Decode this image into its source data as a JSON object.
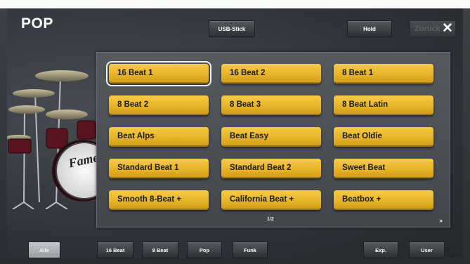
{
  "header": {
    "title": "POP",
    "usb_label": "USB-Stick",
    "hold_label": "Hold",
    "back_label": "Zurück",
    "close_icon": "✕"
  },
  "drum_logo": "Fame",
  "styles": [
    "16 Beat 1",
    "16 Beat 2",
    "8 Beat 1",
    "8 Beat 2",
    "8 Beat 3",
    "8 Beat Latin",
    "Beat Alps",
    "Beat Easy",
    "Beat Oldie",
    "Standard Beat 1",
    "Standard Beat 2",
    "Sweet Beat",
    "Smooth 8-Beat +",
    "California Beat +",
    "Beatbox +"
  ],
  "selected_style": "16 Beat 1",
  "pager": {
    "page": "1/2",
    "next_icon": "»"
  },
  "categories": [
    "Alle",
    "16 Beat",
    "8 Beat",
    "Pop",
    "Funk"
  ],
  "active_category": "Alle",
  "right_buttons": {
    "exp_label": "Exp.",
    "user_label": "User"
  },
  "colors": {
    "style_button": "#eab72c",
    "background": "#34383d"
  }
}
